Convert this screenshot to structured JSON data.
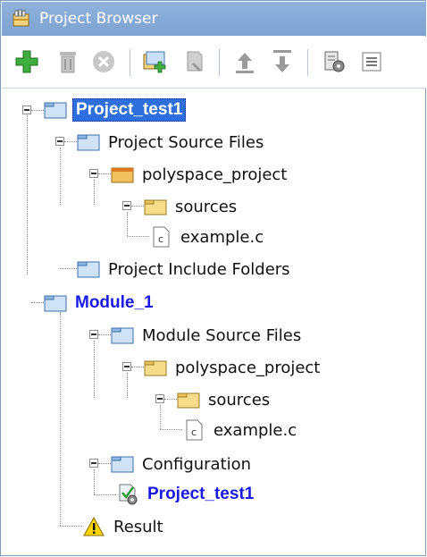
{
  "panel": {
    "title": "Project Browser"
  },
  "toolbar": {
    "buttons": [
      {
        "name": "add-icon",
        "enabled": true
      },
      {
        "name": "delete-icon",
        "enabled": false
      },
      {
        "name": "remove-icon",
        "enabled": false
      },
      {
        "name": "new-folder-icon",
        "enabled": true
      },
      {
        "name": "module-icon",
        "enabled": false
      },
      {
        "name": "move-up-icon",
        "enabled": true
      },
      {
        "name": "move-down-icon",
        "enabled": true
      },
      {
        "name": "run-config-icon",
        "enabled": true
      },
      {
        "name": "properties-icon",
        "enabled": true
      }
    ]
  },
  "tree": {
    "project": {
      "label": "Project_test1",
      "selected": true
    },
    "project_source_files": {
      "label": "Project Source Files"
    },
    "ps_polyspace_project": {
      "label": "polyspace_project"
    },
    "ps_sources": {
      "label": "sources"
    },
    "ps_example": {
      "label": "example.c"
    },
    "project_include_folders": {
      "label": "Project Include Folders"
    },
    "module": {
      "label": "Module_1"
    },
    "module_source_files": {
      "label": "Module Source Files"
    },
    "ms_polyspace_project": {
      "label": "polyspace_project"
    },
    "ms_sources": {
      "label": "sources"
    },
    "ms_example": {
      "label": "example.c"
    },
    "configuration": {
      "label": "Configuration"
    },
    "config_project": {
      "label": "Project_test1"
    },
    "result": {
      "label": "Result"
    }
  },
  "colors": {
    "title_bar": "#8fb2dd",
    "link_text": "#1a1ae6",
    "selection": "#2f6fdc"
  }
}
